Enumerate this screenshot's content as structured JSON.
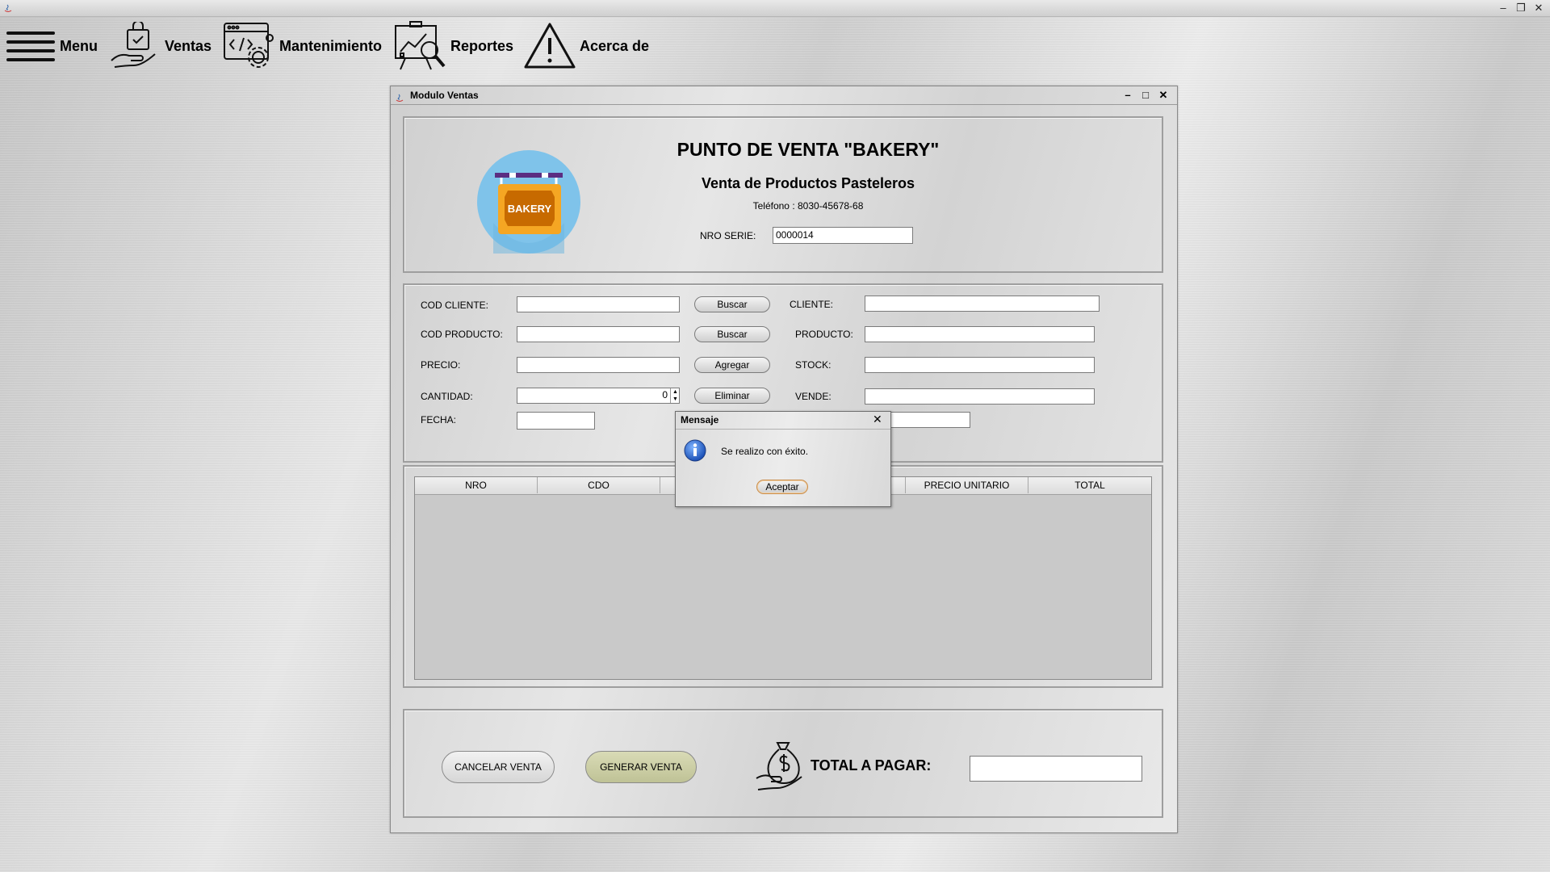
{
  "window": {
    "controls": [
      "–",
      "❐",
      "✕"
    ]
  },
  "menu": {
    "items": [
      {
        "label": "Menu",
        "icon": "hamburger-icon"
      },
      {
        "label": "Ventas",
        "icon": "shopping-hand-icon"
      },
      {
        "label": "Mantenimiento",
        "icon": "code-gear-icon"
      },
      {
        "label": "Reportes",
        "icon": "report-chart-icon"
      },
      {
        "label": "Acerca de",
        "icon": "warning-icon"
      }
    ]
  },
  "frame": {
    "title": "Modulo Ventas",
    "controls": [
      "–",
      "□",
      "✕"
    ]
  },
  "header": {
    "title": "PUNTO DE VENTA \"BAKERY\"",
    "subtitle": "Venta de Productos Pasteleros",
    "phone": "Teléfono : 8030-45678-68",
    "serie_label": "NRO SERIE:",
    "serie_value": "0000014",
    "logo_text": "BAKERY"
  },
  "form": {
    "cod_cliente_label": "COD CLIENTE:",
    "cod_producto_label": "COD PRODUCTO:",
    "precio_label": "PRECIO:",
    "cantidad_label": "CANTIDAD:",
    "cantidad_value": "0",
    "fecha_label": "FECHA:",
    "buscar_cliente": "Buscar",
    "buscar_producto": "Buscar",
    "agregar": "Agregar",
    "eliminar": "Eliminar",
    "cliente_label": "CLIENTE:",
    "producto_label": "PRODUCTO:",
    "stock_label": "STOCK:",
    "vende_label": "VENDE:"
  },
  "table": {
    "columns": [
      "NRO",
      "CDO",
      "",
      "",
      "PRECIO UNITARIO",
      "TOTAL"
    ]
  },
  "footer": {
    "cancel": "CANCELAR VENTA",
    "generate": "GENERAR VENTA",
    "total_label": "TOTAL A PAGAR:",
    "total_value": ""
  },
  "dialog": {
    "title": "Mensaje",
    "message": "Se realizo con éxito.",
    "accept": "Aceptar",
    "close": "✕"
  },
  "colors": {
    "generate_button": "#c9cca3",
    "logo_circle": "#7fc3ea",
    "logo_sign": "#e07b00"
  }
}
